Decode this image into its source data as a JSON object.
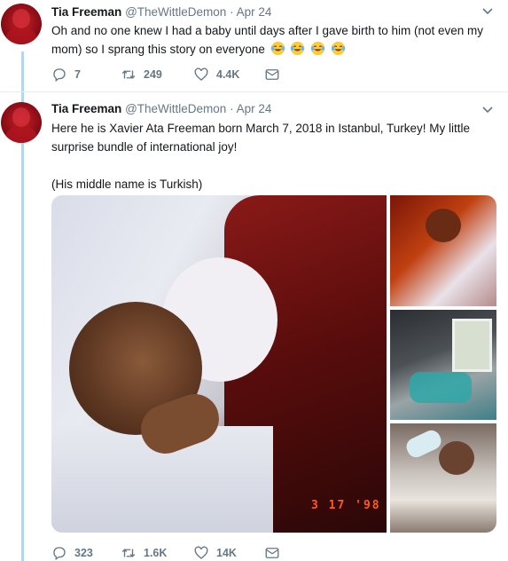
{
  "tweets": [
    {
      "author_name": "Tia Freeman",
      "handle": "@TheWittleDemon",
      "separator": "·",
      "date": "Apr 24",
      "text": "Oh and no one knew I had a baby until days after I gave birth to him (not even my mom) so I sprang this story on everyone",
      "emoji": [
        "face-with-tears-of-joy",
        "face-with-tears-of-joy",
        "face-with-tears-of-joy",
        "face-with-tears-of-joy"
      ],
      "replies": "7",
      "retweets": "249",
      "likes": "4.4K"
    },
    {
      "author_name": "Tia Freeman",
      "handle": "@TheWittleDemon",
      "separator": "·",
      "date": "Apr 24",
      "text_line1": "Here he is Xavier Ata Freeman born March 7, 2018 in Istanbul, Turkey! My little surprise bundle of international joy!",
      "text_line2": "(His middle name is Turkish)",
      "photo_stamp": "3 17 '98",
      "replies": "323",
      "retweets": "1.6K",
      "likes": "14K"
    }
  ],
  "colors": {
    "thread_line": "#b3d7f0",
    "secondary_text": "#657786",
    "primary_text": "#14171a"
  },
  "icons": {
    "reply": "reply-icon",
    "retweet": "retweet-icon",
    "like": "heart-icon",
    "dm": "envelope-icon",
    "menu": "chevron-down-icon"
  }
}
